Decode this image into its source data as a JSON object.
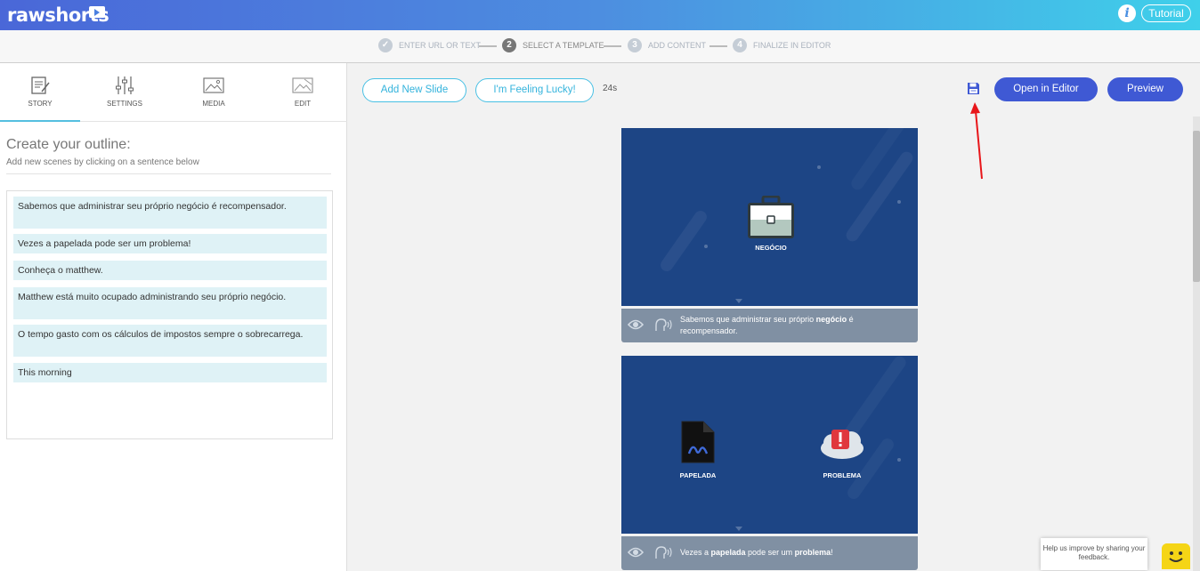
{
  "header": {
    "logo_text": "rawshorts",
    "info_icon": "info-icon",
    "tutorial_label": "Tutorial"
  },
  "steps": [
    {
      "number": "✓",
      "label": "ENTER URL OR TEXT",
      "state": "done"
    },
    {
      "number": "2",
      "label": "SELECT A TEMPLATE",
      "state": "active"
    },
    {
      "number": "3",
      "label": "ADD CONTENT",
      "state": "pending"
    },
    {
      "number": "4",
      "label": "FINALIZE IN EDITOR",
      "state": "pending"
    }
  ],
  "left_tabs": [
    {
      "label": "STORY",
      "icon": "story-icon",
      "active": true
    },
    {
      "label": "SETTINGS",
      "icon": "settings-sliders-icon",
      "active": false
    },
    {
      "label": "MEDIA",
      "icon": "media-image-icon",
      "active": false
    },
    {
      "label": "EDIT",
      "icon": "edit-image-icon",
      "active": false
    }
  ],
  "outline": {
    "title": "Create your outline:",
    "subtitle": "Add new scenes by clicking on a sentence below",
    "sentences": [
      "Sabemos que administrar seu próprio negócio é recompensador.",
      "Vezes a papelada pode ser um problema!",
      "Conheça o matthew.",
      "Matthew está muito ocupado administrando seu próprio negócio.",
      "O tempo gasto com os cálculos de impostos sempre o sobrecarrega.",
      "This morning"
    ]
  },
  "toolbar": {
    "add_slide_label": "Add New Slide",
    "lucky_label": "I'm Feeling Lucky!",
    "duration": "24s",
    "save_icon": "save-floppy-icon",
    "open_editor_label": "Open in Editor",
    "preview_label": "Preview"
  },
  "slides": [
    {
      "labels": [
        "NEGÓCIO"
      ],
      "icons": [
        "briefcase-icon"
      ],
      "caption_parts": [
        "Sabemos que administrar seu próprio ",
        "negócio",
        " é recompensador."
      ]
    },
    {
      "labels": [
        "PAPELADA",
        "PROBLEMA"
      ],
      "icons": [
        "document-signature-icon",
        "alert-cloud-icon"
      ],
      "caption_parts": [
        "Vezes a ",
        "papelada",
        " pode ser um ",
        "problema",
        "!"
      ]
    }
  ],
  "feedback": {
    "text": "Help us improve by sharing your feedback."
  },
  "colors": {
    "header_gradient_start": "#4a67d8",
    "header_gradient_end": "#3fd0ea",
    "primary_button": "#3f59d4",
    "outline_button": "#48c0e4",
    "slide_background": "#1d4585",
    "caption_background": "#8090a3",
    "sentence_background": "#dff2f6"
  }
}
